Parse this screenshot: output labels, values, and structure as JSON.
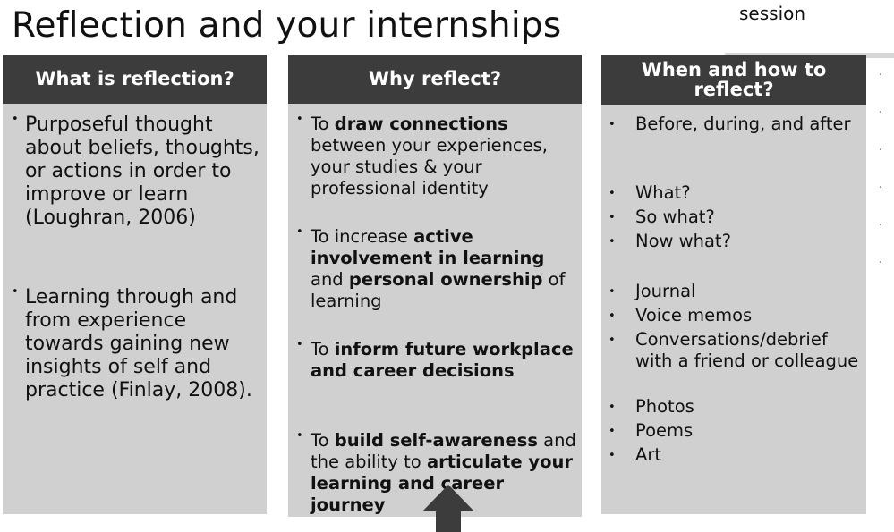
{
  "title": "Reflection and your internships",
  "corner_text": "session",
  "columns": [
    {
      "heading": "What is reflection?",
      "items": [
        "Purposeful thought about beliefs, thoughts, or actions in order to improve or learn (Loughran, 2006)",
        "Learning through and from experience towards gaining new insights of self and practice (Finlay, 2008)."
      ]
    },
    {
      "heading": "Why reflect?",
      "items": [
        [
          "To ",
          "draw connections",
          " between your experiences, your studies & your professional identity"
        ],
        [
          "To increase ",
          "active involvement in learning",
          " and ",
          "personal ownership",
          " of learning"
        ],
        [
          "To ",
          "inform future workplace and career decisions"
        ],
        [
          "To ",
          "build self-awareness",
          " and the ability to ",
          "articulate your learning and career journey"
        ]
      ]
    },
    {
      "heading": "When and how to reflect?",
      "items": [
        "Before, during, and after",
        "What?",
        "So what?",
        "Now what?",
        "Journal",
        "Voice memos",
        "Conversations/debrief with a friend or colleague",
        "Photos",
        "Poems",
        "Art"
      ]
    }
  ],
  "right_edge_dots": [
    ".",
    ".",
    ".",
    ".",
    ".",
    "."
  ],
  "colors": {
    "header_bg": "#3c3c3c",
    "panel_bg": "#d0d0d0",
    "arrow": "#3c3c3c"
  },
  "icons": {
    "arrow": "up-arrow-icon"
  }
}
